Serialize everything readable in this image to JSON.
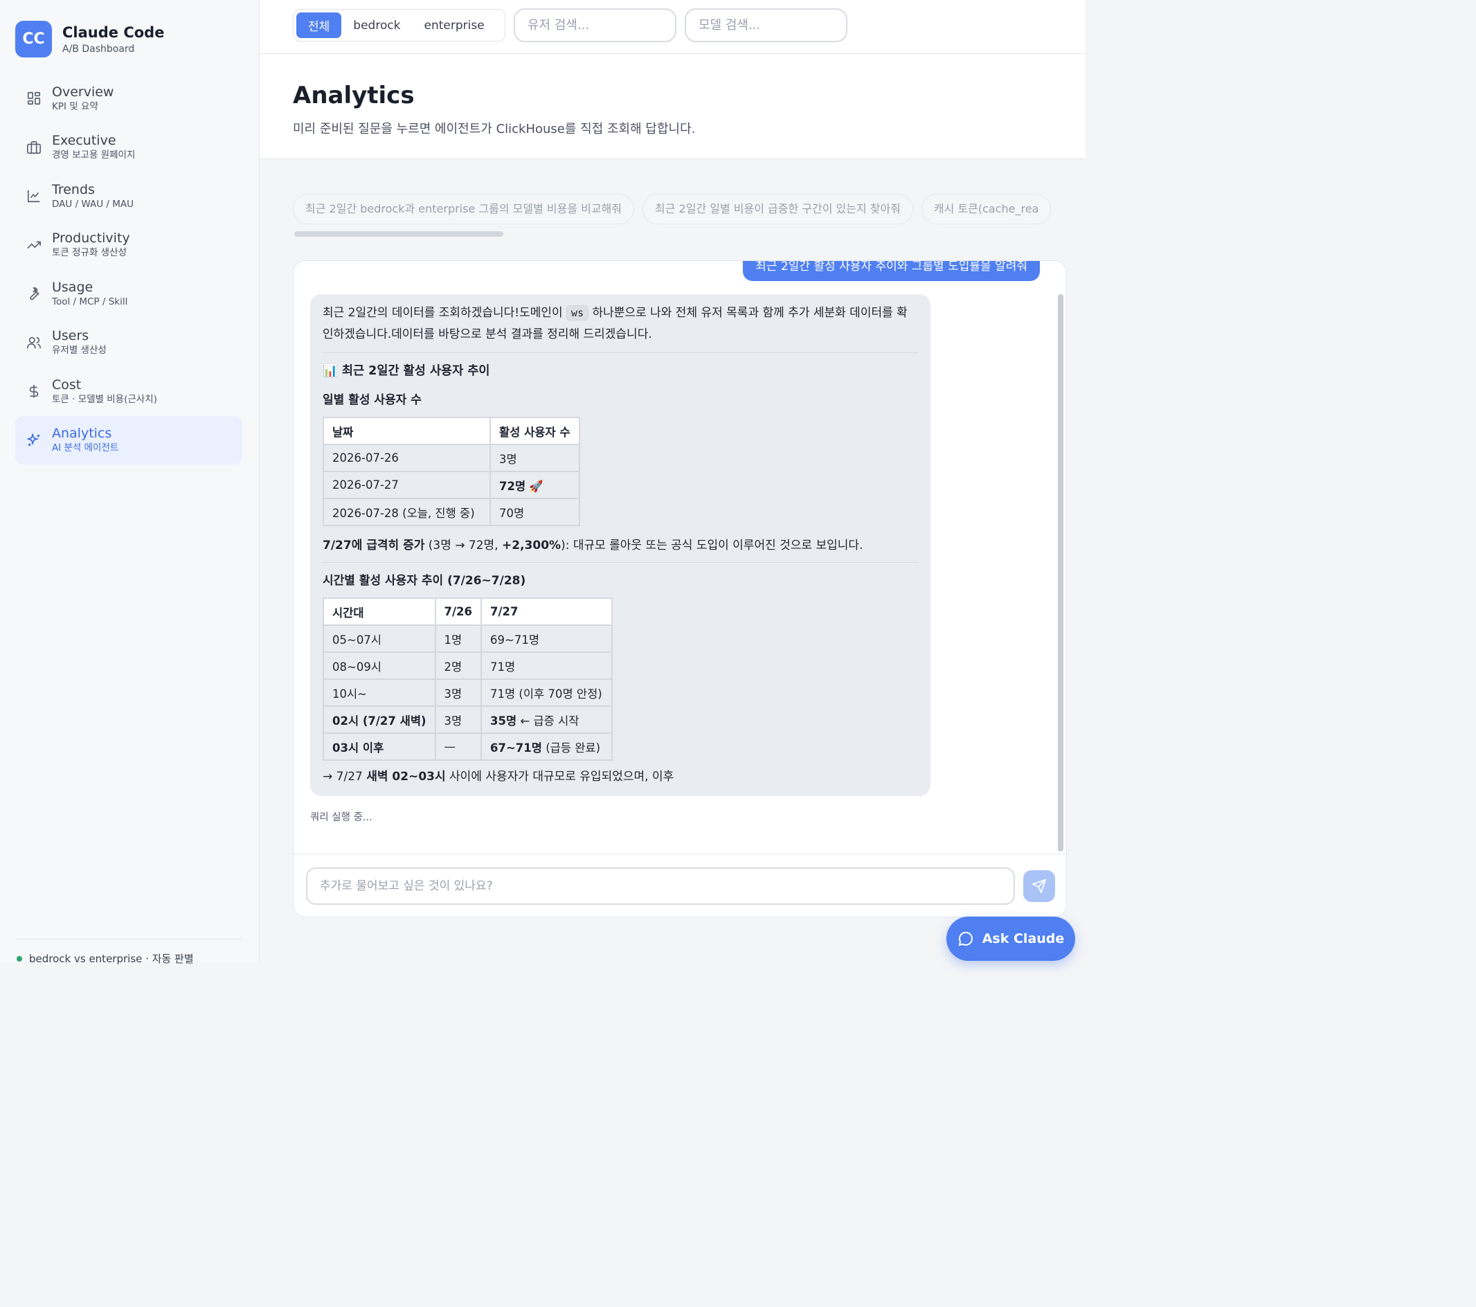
{
  "brand": {
    "logo": "CC",
    "title": "Claude Code",
    "subtitle": "A/B Dashboard"
  },
  "nav": [
    {
      "label": "Overview",
      "sub": "KPI 및 요약",
      "icon": "grid-icon"
    },
    {
      "label": "Executive",
      "sub": "경영 보고용 원페이지",
      "icon": "briefcase-icon"
    },
    {
      "label": "Trends",
      "sub": "DAU / WAU / MAU",
      "icon": "line-chart-icon"
    },
    {
      "label": "Productivity",
      "sub": "토큰 정규화 생산성",
      "icon": "trending-up-icon"
    },
    {
      "label": "Usage",
      "sub": "Tool / MCP / Skill",
      "icon": "wrench-icon"
    },
    {
      "label": "Users",
      "sub": "유저별 생산성",
      "icon": "users-icon"
    },
    {
      "label": "Cost",
      "sub": "토큰 · 모델별 비용(근사치)",
      "icon": "dollar-icon"
    },
    {
      "label": "Analytics",
      "sub": "AI 분석 에이전트",
      "icon": "sparkles-icon",
      "active": true
    }
  ],
  "sidebar_footer": "bedrock vs enterprise · 자동 판별",
  "filters": {
    "segments": [
      "전체",
      "bedrock",
      "enterprise"
    ],
    "active_segment": "전체",
    "user_search_placeholder": "유저 검색...",
    "model_search_placeholder": "모델 검색..."
  },
  "header": {
    "title": "Analytics",
    "description": "미리 준비된 질문을 누르면 에이전트가 ClickHouse를 직접 조회해 답합니다."
  },
  "suggestions": [
    "최근 2일간 bedrock과 enterprise 그룹의 모델별 비용을 비교해줘",
    "최근 2일간 일별 비용이 급증한 구간이 있는지 찾아줘",
    "캐시 토큰(cache_rea"
  ],
  "chat": {
    "user_message": "최근 2일간 활성 사용자 추이와 그룹별 도입률을 알려줘",
    "intro_1": "최근 2일간의 데이터를 조회하겠습니다!도메인이 ",
    "intro_code": "ws",
    "intro_2": " 하나뿐으로 나와 전체 유저 목록과 함께 추가 세분화 데이터를 확인하겠습니다.데이터를 바탕으로 분석 결과를 정리해 드리겠습니다.",
    "section_emoji": "📊",
    "section_title": "최근 2일간 활성 사용자 추이",
    "daily_title": "일별 활성 사용자 수",
    "daily_headers": [
      "날짜",
      "활성 사용자 수"
    ],
    "daily_rows": [
      {
        "date": "2026-07-26",
        "count": "3명",
        "bold": false,
        "emoji": ""
      },
      {
        "date": "2026-07-27",
        "count": "72명",
        "bold": true,
        "emoji": "🚀"
      },
      {
        "date": "2026-07-28 (오늘, 진행 중)",
        "count": "70명",
        "bold": false,
        "emoji": ""
      }
    ],
    "summary_bold": "7/27에 급격히 증가",
    "summary_1": " (3명 → 72명, ",
    "summary_pct": "+2,300%",
    "summary_2": "): 대규모 롤아웃 또는 공식 도입이 이루어진 것으로 보입니다.",
    "hourly_title": "시간별 활성 사용자 추이 (7/26~7/28)",
    "hourly_headers": [
      "시간대",
      "7/26",
      "7/27"
    ],
    "hourly_rows": [
      {
        "slot": "05~07시",
        "d26": "1명",
        "d27": "69~71명",
        "bold_slot": false,
        "d27_bold": "",
        "d27_rest": ""
      },
      {
        "slot": "08~09시",
        "d26": "2명",
        "d27": "71명",
        "bold_slot": false,
        "d27_bold": "",
        "d27_rest": ""
      },
      {
        "slot": "10시~",
        "d26": "3명",
        "d27": "71명 (이후 70명 안정)",
        "bold_slot": false,
        "d27_bold": "",
        "d27_rest": ""
      },
      {
        "slot": "02시 (7/27 새벽)",
        "d26": "3명",
        "d27": "",
        "bold_slot": true,
        "d27_bold": "35명",
        "d27_rest": " ← 급증 시작"
      },
      {
        "slot": "03시 이후",
        "d26": "—",
        "d27": "",
        "bold_slot": true,
        "d27_bold": "67~71명",
        "d27_rest": " (급등 완료)"
      }
    ],
    "footer_1": "→ 7/27 ",
    "footer_bold": "새벽 02~03시",
    "footer_2": " 사이에 사용자가 대규모로 유입되었으며, 이후",
    "status": "쿼리 실행 중...",
    "input_placeholder": "추가로 물어보고 싶은 것이 있나요?"
  },
  "ask_button": "Ask Claude",
  "colors": {
    "accent": "#4f7ff0",
    "active_bg": "#eaf0fd",
    "status_dot": "#2ca66f"
  }
}
